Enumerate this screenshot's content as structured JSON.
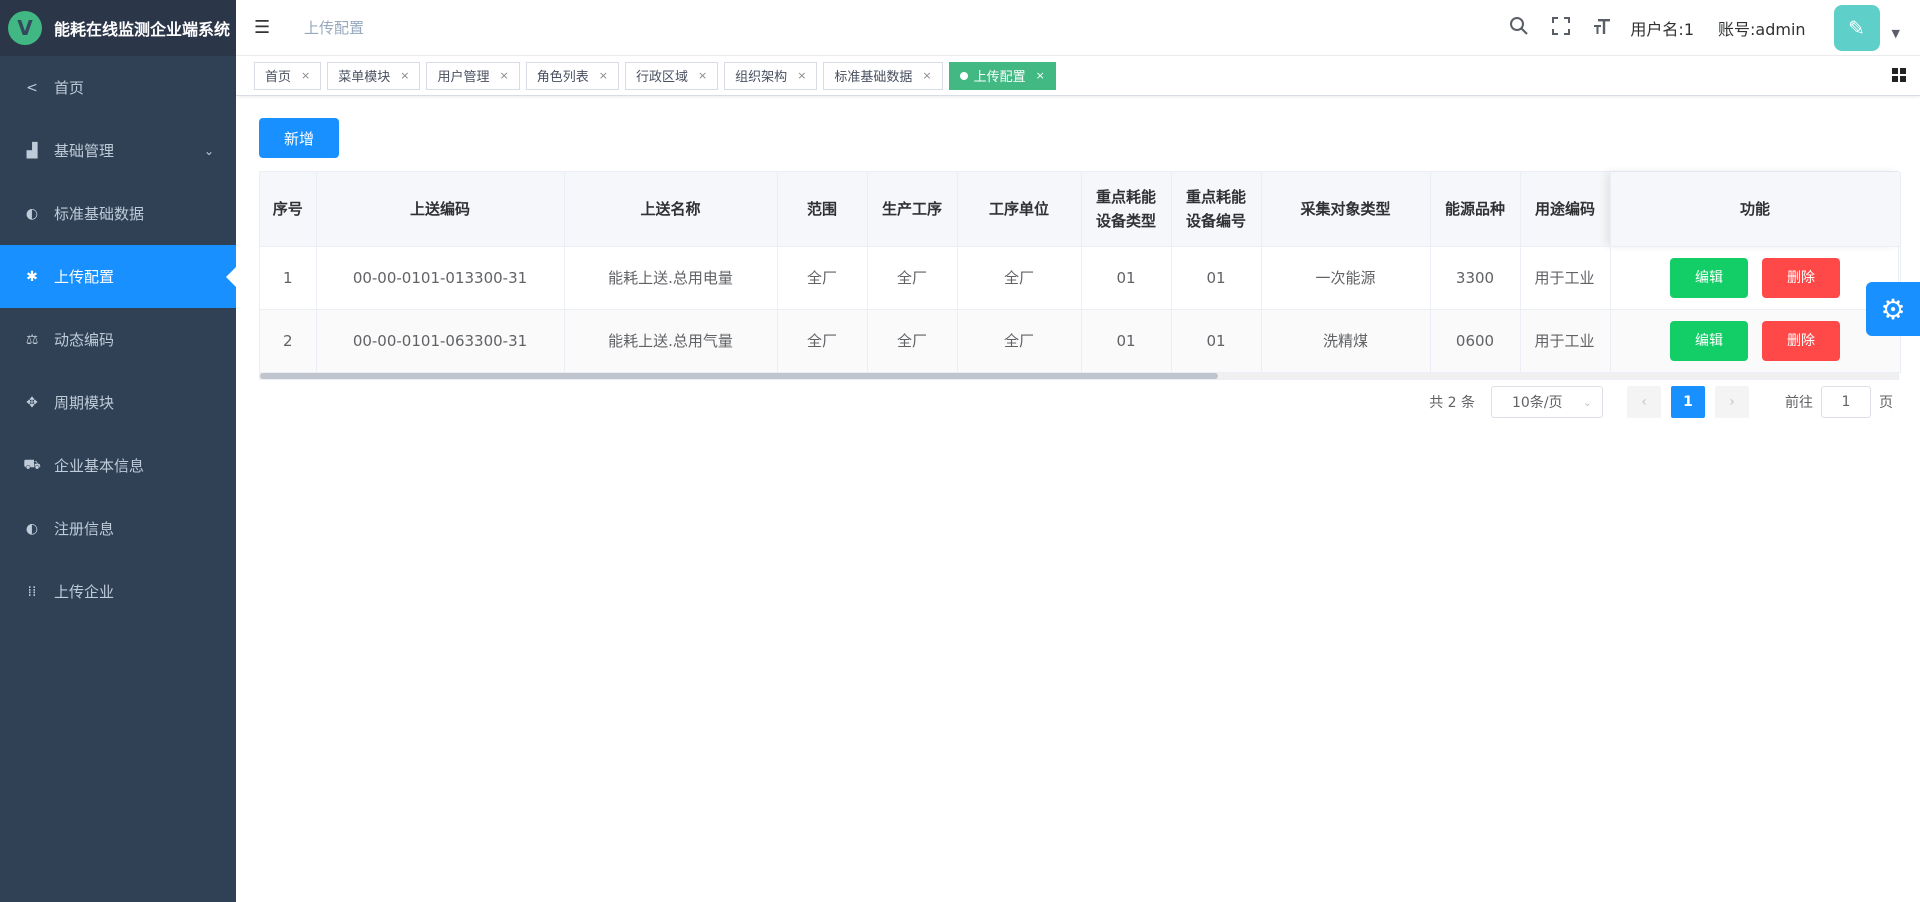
{
  "app": {
    "title": "能耗在线监测企业端系统",
    "logo_letter": "V"
  },
  "sidebar": {
    "items": [
      {
        "label": "首页",
        "icon": "share-icon",
        "glyph": "<"
      },
      {
        "label": "基础管理",
        "icon": "area-chart-icon",
        "glyph": "▟",
        "arrow": "⌄"
      },
      {
        "label": "标准基础数据",
        "icon": "half-circle-icon",
        "glyph": "◐"
      },
      {
        "label": "上传配置",
        "icon": "asterisk-icon",
        "glyph": "✱"
      },
      {
        "label": "动态编码",
        "icon": "scale-icon",
        "glyph": "⚖"
      },
      {
        "label": "周期模块",
        "icon": "move-icon",
        "glyph": "✥"
      },
      {
        "label": "企业基本信息",
        "icon": "car-icon",
        "glyph": "⛟"
      },
      {
        "label": "注册信息",
        "icon": "half-circle-icon",
        "glyph": "◐"
      },
      {
        "label": "上传企业",
        "icon": "grid-dots-icon",
        "glyph": "⁞⁞"
      }
    ]
  },
  "navbar": {
    "breadcrumb": "上传配置",
    "username": "用户名:1",
    "account": "账号:admin"
  },
  "tags": [
    {
      "label": "首页",
      "close": "×"
    },
    {
      "label": "菜单模块",
      "close": "×"
    },
    {
      "label": "用户管理",
      "close": "×"
    },
    {
      "label": "角色列表",
      "close": "×"
    },
    {
      "label": "行政区域",
      "close": "×"
    },
    {
      "label": "组织架构",
      "close": "×"
    },
    {
      "label": "标准基础数据",
      "close": "×"
    },
    {
      "label": "上传配置",
      "close": "×"
    }
  ],
  "toolbar": {
    "add_label": "新增"
  },
  "table": {
    "headers": {
      "idx": "序号",
      "code": "上送编码",
      "name": "上送名称",
      "scope": "范围",
      "process": "生产工序",
      "unit": "工序单位",
      "dev_type_1": "重点耗能",
      "dev_type_2": "设备类型",
      "dev_no_1": "重点耗能",
      "dev_no_2": "设备编号",
      "obj_type": "采集对象类型",
      "energy": "能源品种",
      "usage": "用途编码",
      "actions": "功能"
    },
    "rows": [
      {
        "idx": "1",
        "code": "00-00-0101-013300-31",
        "name": "能耗上送.总用电量",
        "scope": "全厂",
        "process": "全厂",
        "unit": "全厂",
        "dev_type": "01",
        "dev_no": "01",
        "obj_type": "一次能源",
        "energy": "3300",
        "usage": "用于工业"
      },
      {
        "idx": "2",
        "code": "00-00-0101-063300-31",
        "name": "能耗上送.总用气量",
        "scope": "全厂",
        "process": "全厂",
        "unit": "全厂",
        "dev_type": "01",
        "dev_no": "01",
        "obj_type": "洗精煤",
        "energy": "0600",
        "usage": "用于工业"
      }
    ],
    "edit_label": "编辑",
    "delete_label": "删除"
  },
  "pagination": {
    "total": "共 2 条",
    "page_size": "10条/页",
    "current_page": "1",
    "goto_label": "前往",
    "goto_value": "1",
    "page_suffix": "页"
  }
}
